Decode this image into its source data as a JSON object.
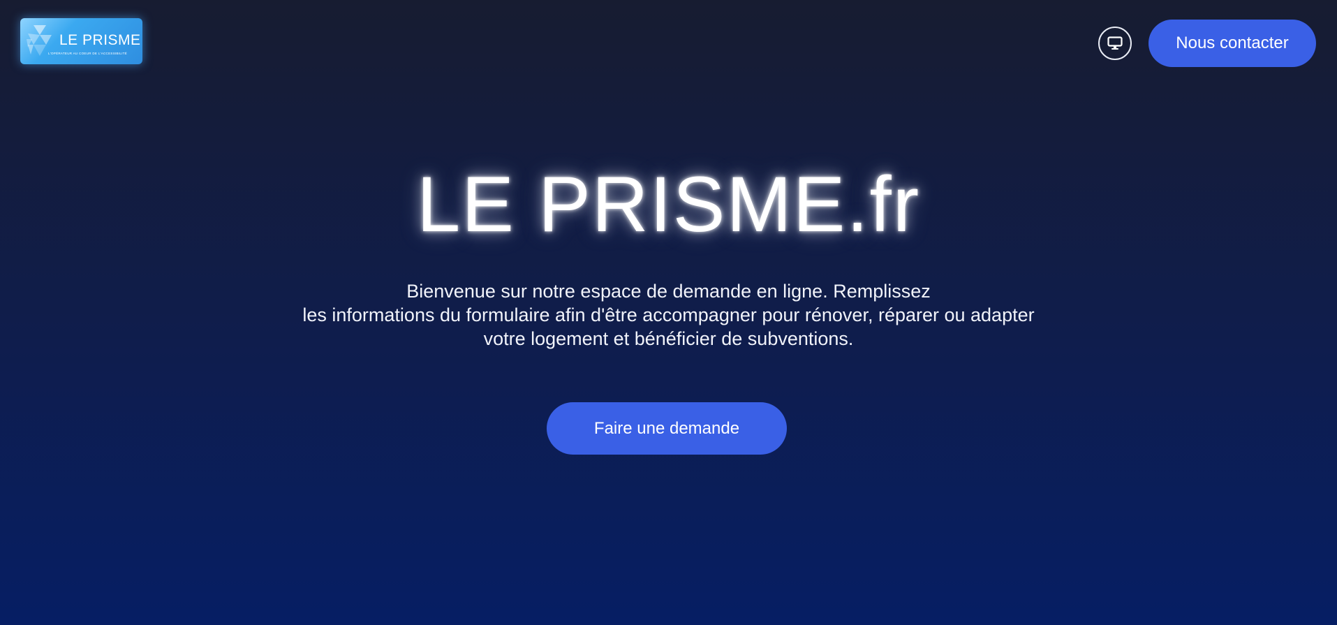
{
  "header": {
    "logo": {
      "name": "LE PRISME",
      "tagline": "L'OPÉRATEUR AU COEUR DE L'ACCESSIBILITÉ",
      "icon": "prism-logo-icon"
    },
    "display_toggle_icon": "monitor-icon",
    "contact_label": "Nous contacter"
  },
  "hero": {
    "title": "LE PRISME.fr",
    "intro_lines": [
      "Bienvenue sur notre espace de demande en ligne. Remplissez",
      "les informations du formulaire afin d'être accompagner pour rénover, réparer ou adapter",
      "votre logement et bénéficier de subventions."
    ],
    "cta_label": "Faire une demande"
  },
  "colors": {
    "accent": "#3a60e6",
    "background_top": "#171c31",
    "background_bottom": "#061e64",
    "logo_blue": "#3ba9f0"
  }
}
